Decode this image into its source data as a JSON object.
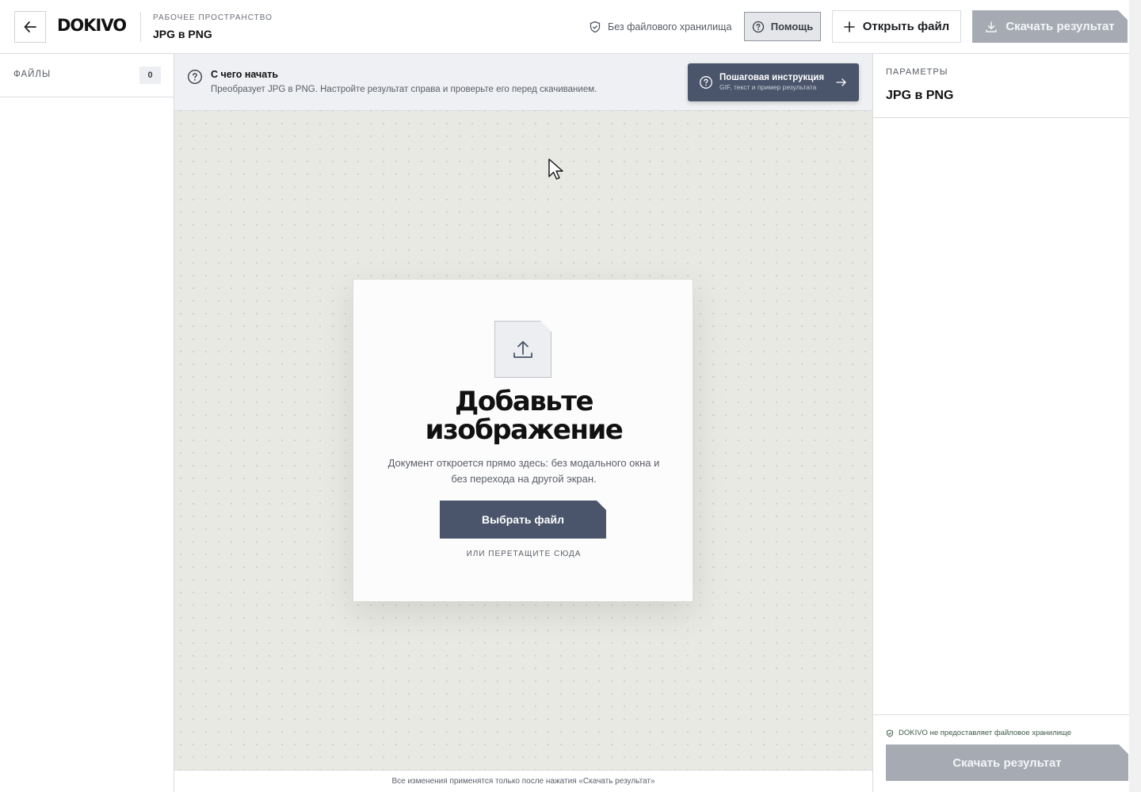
{
  "header": {
    "back_icon": "arrow-left-icon",
    "logo": "DOKIVO",
    "workspace_label": "РАБОЧЕЕ ПРОСТРАНСТВО",
    "workspace_title": "JPG в PNG",
    "storage_note": "Без файлового хранилища",
    "help_label": "Помощь",
    "open_file_label": "Открыть файл",
    "download_label": "Скачать результат"
  },
  "sidebar": {
    "files_label": "ФАЙЛЫ",
    "files_count": "0"
  },
  "info_bar": {
    "title": "С чего начать",
    "text": "Преобразует JPG в PNG. Настройте результат справа и проверьте его перед скачиванием.",
    "guide_title": "Пошаговая инструкция",
    "guide_subtitle": "GIF, текст и пример результата"
  },
  "upload_card": {
    "title": "Добавьте изображение",
    "text": "Документ откроется прямо здесь: без модального окна и без перехода на другой экран.",
    "choose_button": "Выбрать файл",
    "drag_note": "ИЛИ ПЕРЕТАЩИТЕ СЮДА"
  },
  "footer_note": "Все изменения применятся только после нажатия «Скачать результат»",
  "params": {
    "label": "ПАРАМЕТРЫ",
    "title": "JPG в PNG",
    "no_storage_note": "DOKIVO не предоставляет файловое хранилище",
    "download_label": "Скачать результат"
  },
  "colors": {
    "accent": "#4a556b",
    "disabled_button": "#a6abb3",
    "canvas": "#e9e9e4"
  }
}
